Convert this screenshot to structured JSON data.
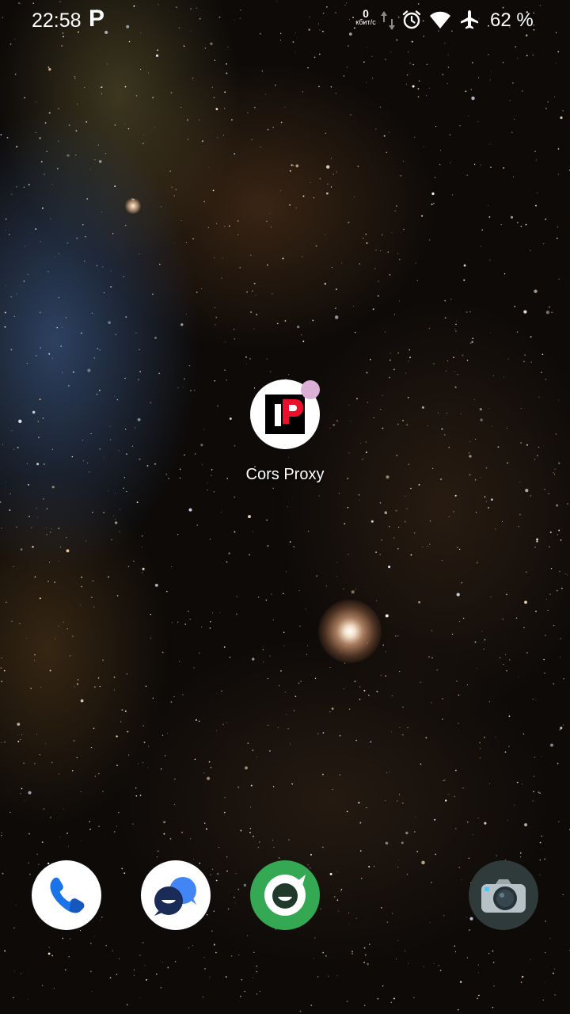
{
  "status_bar": {
    "time": "22:58",
    "notification_glyph": "P",
    "net_speed_value": "0",
    "net_speed_unit": "кбит/с",
    "battery": "62 %",
    "icons": [
      "data-arrows-icon",
      "alarm-icon",
      "wifi-icon",
      "airplane-icon"
    ]
  },
  "home": {
    "apps": [
      {
        "label": "Cors Proxy",
        "icon": "cors-proxy-app-icon",
        "badge": true
      }
    ]
  },
  "dock": {
    "items": [
      {
        "icon": "phone-icon",
        "color": "#1a73e8"
      },
      {
        "icon": "messages-icon",
        "color": "#4285f4"
      },
      {
        "icon": "chat-app-icon",
        "color": "#34a853"
      },
      {
        "icon": "camera-icon",
        "color": "#2f3a3b"
      }
    ]
  },
  "colors": {
    "badge": "#dcb0d6",
    "cors_proxy_red": "#e8102a"
  }
}
